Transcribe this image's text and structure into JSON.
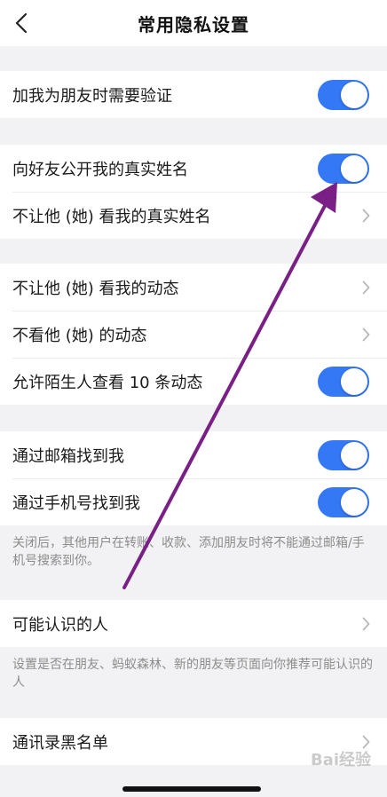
{
  "nav": {
    "title": "常用隐私设置"
  },
  "group1": {
    "rows": [
      {
        "label": "加我为朋友时需要验证",
        "toggle_on": true
      }
    ]
  },
  "group2": {
    "rows": [
      {
        "label": "向好友公开我的真实姓名",
        "toggle_on": true
      },
      {
        "label": "不让他 (她) 看我的真实姓名"
      }
    ]
  },
  "group3": {
    "rows": [
      {
        "label": "不让他 (她) 看我的动态"
      },
      {
        "label": "不看他 (她) 的动态"
      },
      {
        "label": "允许陌生人查看 10 条动态",
        "toggle_on": true
      }
    ]
  },
  "group4": {
    "rows": [
      {
        "label": "通过邮箱找到我",
        "toggle_on": true
      },
      {
        "label": "通过手机号找到我",
        "toggle_on": true
      }
    ],
    "hint": "关闭后，其他用户在转账、收款、添加朋友时将不能通过邮箱/手机号搜索到你。"
  },
  "group5": {
    "rows": [
      {
        "label": "可能认识的人"
      }
    ],
    "hint": "设置是否在朋友、蚂蚁森林、新的朋友等页面向你推荐可能认识的人"
  },
  "group6": {
    "rows": [
      {
        "label": "通讯录黑名单"
      }
    ]
  },
  "watermark": "Bai经验",
  "colors": {
    "accent": "#3478f6",
    "annotation_arrow": "#7a1f86"
  }
}
